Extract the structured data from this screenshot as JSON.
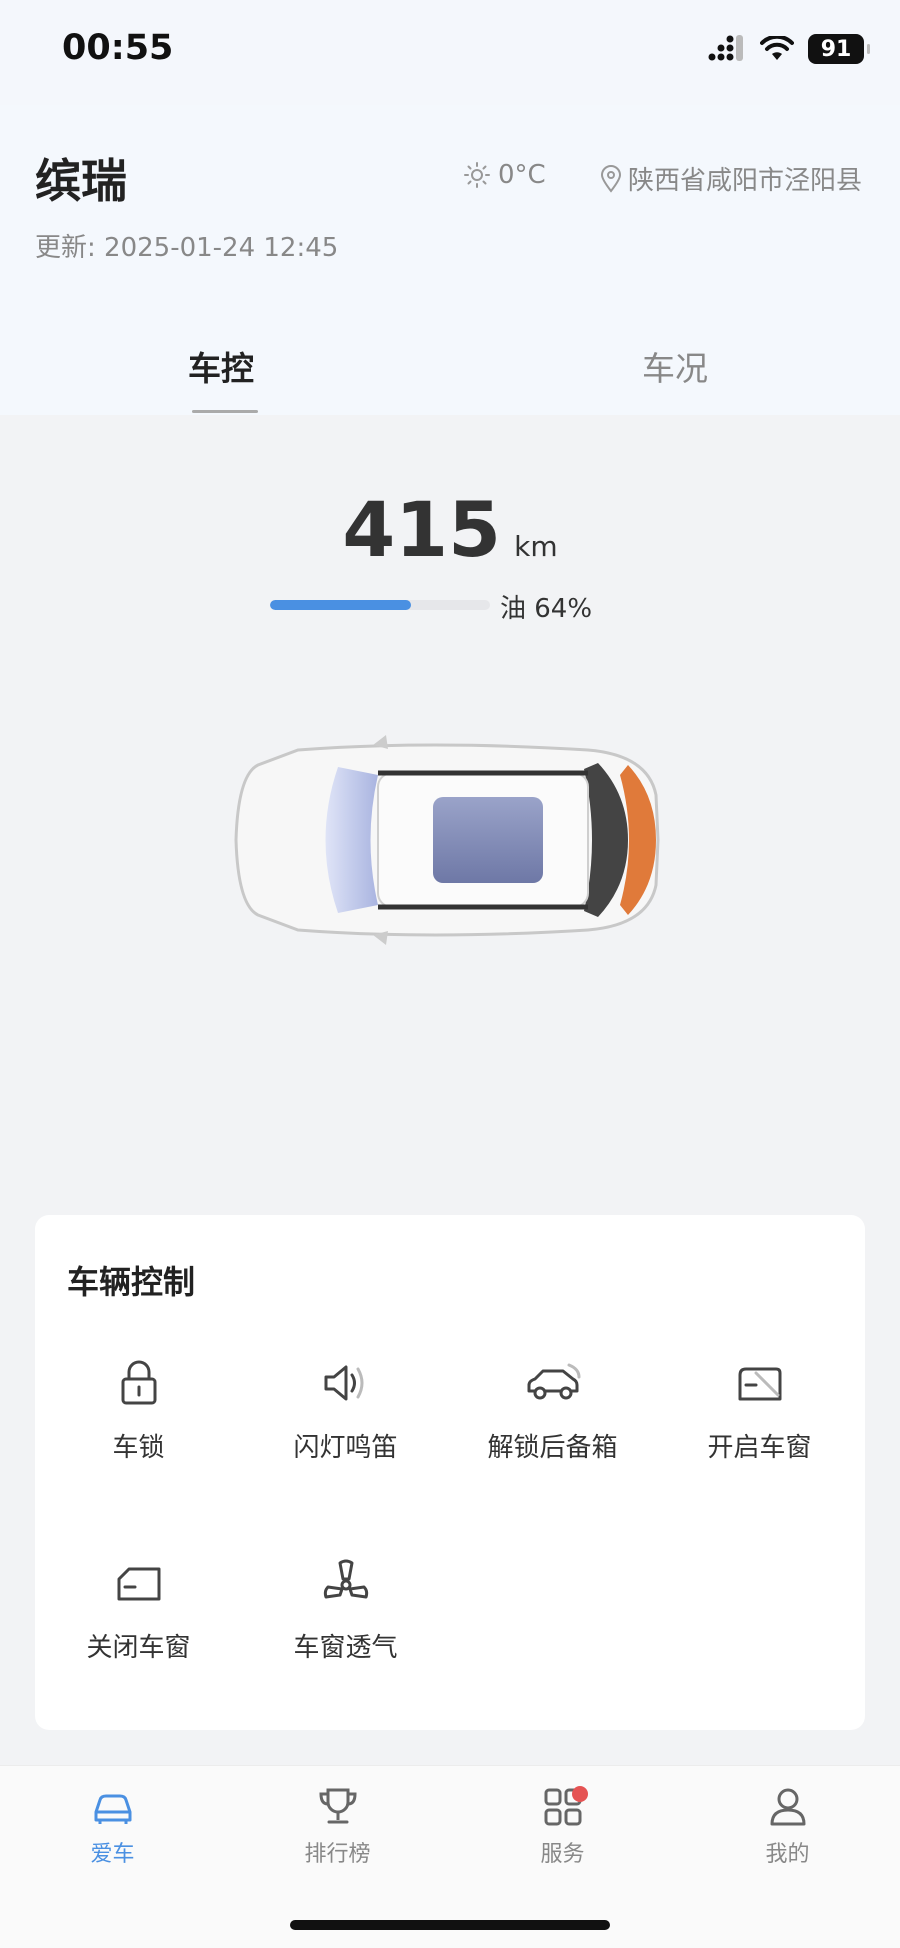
{
  "status": {
    "time": "00:55",
    "battery": "91"
  },
  "header": {
    "car_name": "缤瑞",
    "updated": "更新: 2025-01-24 12:45",
    "temperature": "0°C",
    "location": "陕西省咸阳市泾阳县"
  },
  "tabs": [
    {
      "label": "车控",
      "active": true
    },
    {
      "label": "车况",
      "active": false
    }
  ],
  "range": {
    "value": "415",
    "unit": "km",
    "fuel_label": "油 64%",
    "fuel_fraction": 0.64
  },
  "controls": {
    "title": "车辆控制",
    "items": [
      {
        "label": "车锁",
        "icon": "lock-icon"
      },
      {
        "label": "闪灯鸣笛",
        "icon": "horn-icon"
      },
      {
        "label": "解锁后备箱",
        "icon": "trunk-icon"
      },
      {
        "label": "开启车窗",
        "icon": "window-open-icon"
      },
      {
        "label": "关闭车窗",
        "icon": "window-close-icon"
      },
      {
        "label": "车窗透气",
        "icon": "fan-icon"
      }
    ]
  },
  "nav": [
    {
      "label": "爱车",
      "icon": "car-icon",
      "active": true
    },
    {
      "label": "排行榜",
      "icon": "trophy-icon",
      "active": false
    },
    {
      "label": "服务",
      "icon": "grid-icon",
      "active": false,
      "badge": true
    },
    {
      "label": "我的",
      "icon": "user-icon",
      "active": false
    }
  ],
  "colors": {
    "accent": "#4a90e2",
    "badge": "#e55353",
    "background": "#f2f3f5"
  }
}
